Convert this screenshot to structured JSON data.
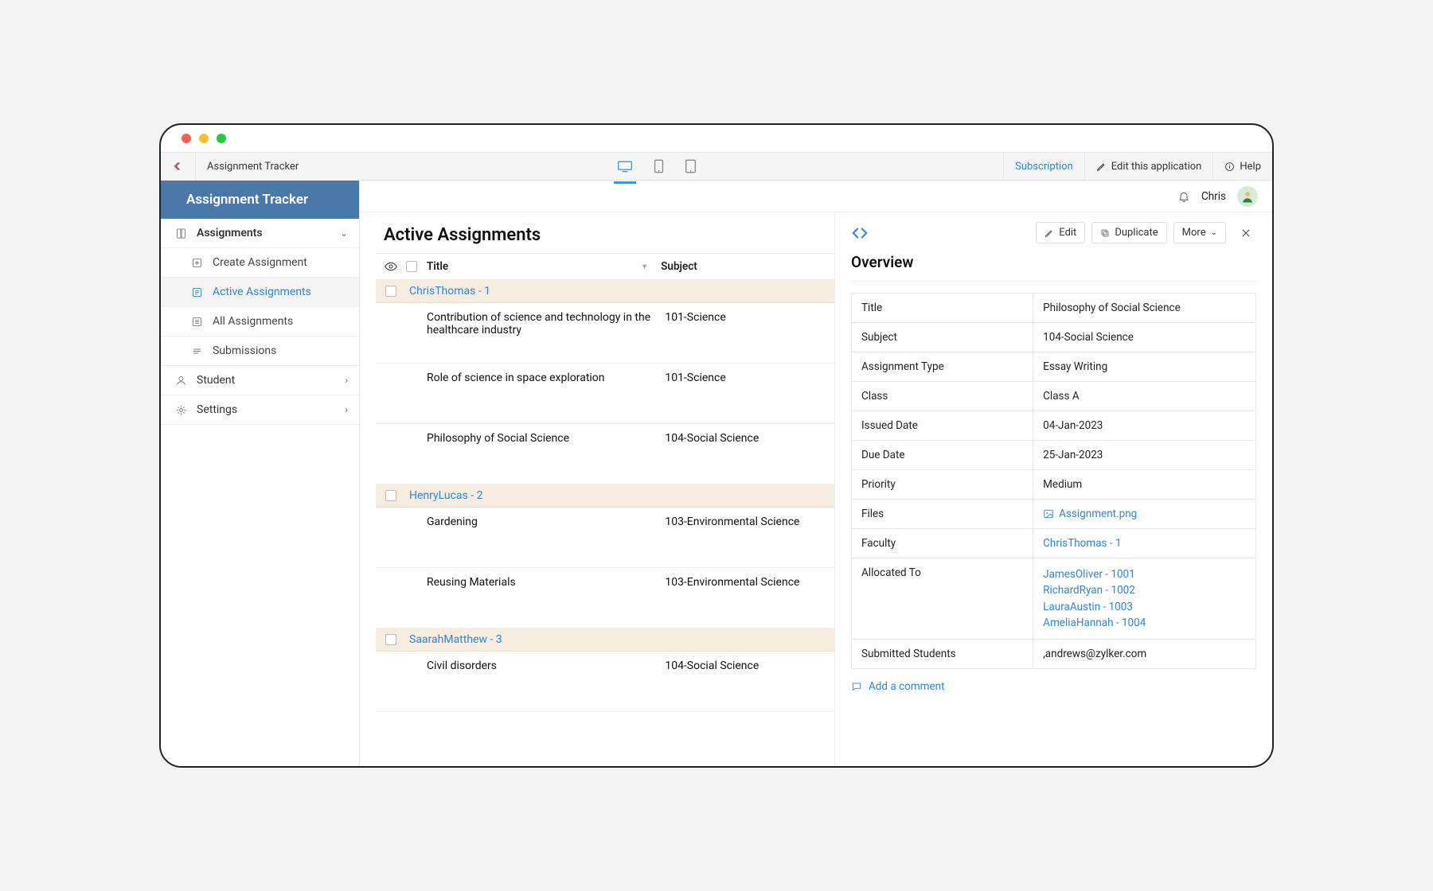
{
  "topbar": {
    "app_label": "Assignment Tracker",
    "subscription": "Subscription",
    "edit_app": "Edit this application",
    "help": "Help"
  },
  "brand": "Assignment Tracker",
  "sidebar": {
    "assignments": "Assignments",
    "create": "Create Assignment",
    "active": "Active Assignments",
    "all": "All Assignments",
    "submissions": "Submissions",
    "student": "Student",
    "settings": "Settings"
  },
  "user": {
    "name": "Chris"
  },
  "list": {
    "title": "Active Assignments",
    "col_title": "Title",
    "col_subject": "Subject",
    "groups": [
      {
        "name": "ChrisThomas - 1",
        "rows": [
          {
            "title": "Contribution of science and technology in the healthcare industry",
            "subject": "101-Science"
          },
          {
            "title": "Role of science in space exploration",
            "subject": "101-Science"
          },
          {
            "title": "Philosophy of Social Science",
            "subject": "104-Social Science"
          }
        ]
      },
      {
        "name": "HenryLucas - 2",
        "rows": [
          {
            "title": "Gardening",
            "subject": "103-Environmental Science"
          },
          {
            "title": "Reusing Materials",
            "subject": "103-Environmental Science"
          }
        ]
      },
      {
        "name": "SaarahMatthew - 3",
        "rows": [
          {
            "title": "Civil disorders",
            "subject": "104-Social Science"
          }
        ]
      }
    ]
  },
  "detail": {
    "overview": "Overview",
    "edit": "Edit",
    "duplicate": "Duplicate",
    "more": "More",
    "labels": {
      "title": "Title",
      "subject": "Subject",
      "type": "Assignment Type",
      "class": "Class",
      "issued": "Issued Date",
      "due": "Due Date",
      "priority": "Priority",
      "files": "Files",
      "faculty": "Faculty",
      "allocated": "Allocated To",
      "submitted": "Submitted Students"
    },
    "values": {
      "title": "Philosophy of Social Science",
      "subject": "104-Social Science",
      "type": "Essay Writing",
      "class": "Class A",
      "issued": "04-Jan-2023",
      "due": "25-Jan-2023",
      "priority": "Medium",
      "file": "Assignment.png",
      "faculty": "ChrisThomas - 1",
      "allocated": [
        "JamesOliver - 1001",
        "RichardRyan - 1002",
        "LauraAustin - 1003",
        "AmeliaHannah - 1004"
      ],
      "submitted": ",andrews@zylker.com"
    },
    "add_comment": "Add a comment"
  }
}
